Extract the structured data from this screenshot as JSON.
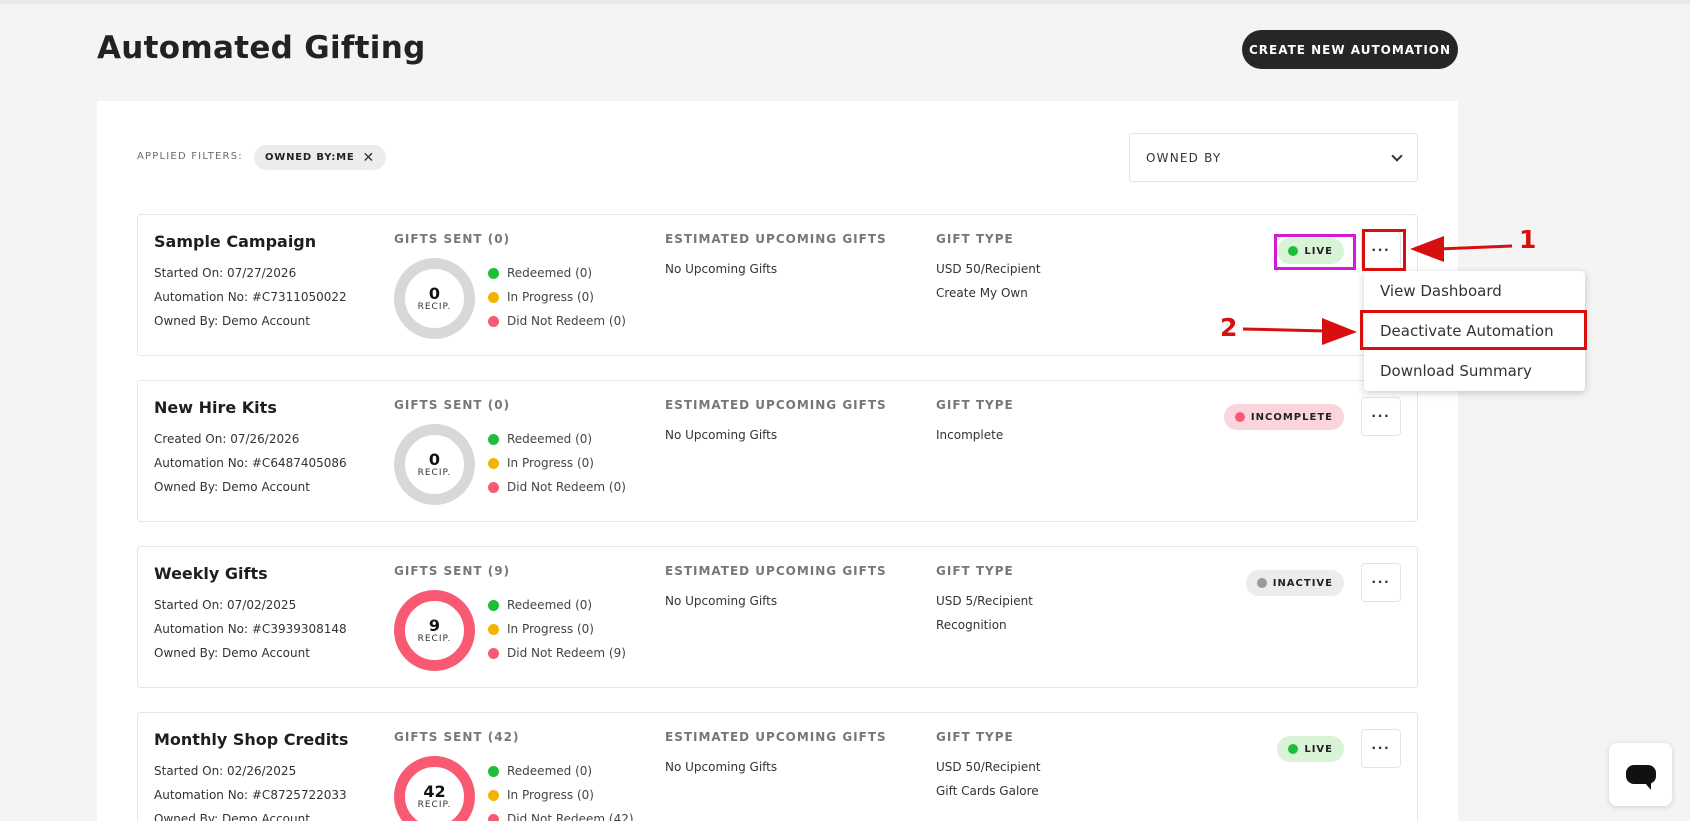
{
  "page": {
    "title": "Automated Gifting",
    "create_button": "CREATE NEW AUTOMATION"
  },
  "filters": {
    "label": "APPLIED FILTERS:",
    "chip": "OWNED BY:ME",
    "chip_remove": "✕",
    "dropdown_label": "OWNED BY"
  },
  "headings": {
    "upcoming": "ESTIMATED UPCOMING GIFTS",
    "gift_type": "GIFT TYPE",
    "recip": "RECIP."
  },
  "legend_colors": {
    "redeemed": "#1fbe3a",
    "in_progress": "#f5b301",
    "did_not_redeem": "#f85a74"
  },
  "campaigns": [
    {
      "name": "Sample Campaign",
      "date_line": "Started On: 07/27/2026",
      "automation_no": "Automation No: #C7311050022",
      "owned_by": "Owned By: Demo Account",
      "gifts_sent": "GIFTS SENT (0)",
      "recipients": "0",
      "redeemed": "Redeemed (0)",
      "in_progress": "In Progress (0)",
      "did_not_redeem": "Did Not Redeem (0)",
      "upcoming": "No Upcoming Gifts",
      "gift_type_1": "USD 50/Recipient",
      "gift_type_2": "Create My Own",
      "status": "LIVE",
      "more": "···"
    },
    {
      "name": "New Hire Kits",
      "date_line": "Created On: 07/26/2026",
      "automation_no": "Automation No: #C6487405086",
      "owned_by": "Owned By: Demo Account",
      "gifts_sent": "GIFTS SENT (0)",
      "recipients": "0",
      "redeemed": "Redeemed (0)",
      "in_progress": "In Progress (0)",
      "did_not_redeem": "Did Not Redeem (0)",
      "upcoming": "No Upcoming Gifts",
      "gift_type_1": "Incomplete",
      "gift_type_2": "",
      "status": "INCOMPLETE",
      "more": "···"
    },
    {
      "name": "Weekly Gifts",
      "date_line": "Started On: 07/02/2025",
      "automation_no": "Automation No: #C3939308148",
      "owned_by": "Owned By: Demo Account",
      "gifts_sent": "GIFTS SENT (9)",
      "recipients": "9",
      "redeemed": "Redeemed (0)",
      "in_progress": "In Progress (0)",
      "did_not_redeem": "Did Not Redeem (9)",
      "upcoming": "No Upcoming Gifts",
      "gift_type_1": "USD 5/Recipient",
      "gift_type_2": "Recognition",
      "status": "INACTIVE",
      "more": "···"
    },
    {
      "name": "Monthly Shop Credits",
      "date_line": "Started On: 02/26/2025",
      "automation_no": "Automation No: #C8725722033",
      "owned_by": "Owned By: Demo Account",
      "gifts_sent": "GIFTS SENT (42)",
      "recipients": "42",
      "redeemed": "Redeemed (0)",
      "in_progress": "In Progress (0)",
      "did_not_redeem": "Did Not Redeem (42)",
      "upcoming": "No Upcoming Gifts",
      "gift_type_1": "USD 50/Recipient",
      "gift_type_2": "Gift Cards Galore",
      "status": "LIVE",
      "more": "···"
    }
  ],
  "menu": {
    "items": [
      "View Dashboard",
      "Deactivate Automation",
      "Download Summary"
    ]
  },
  "annotations": {
    "step1": "1",
    "step2": "2"
  }
}
